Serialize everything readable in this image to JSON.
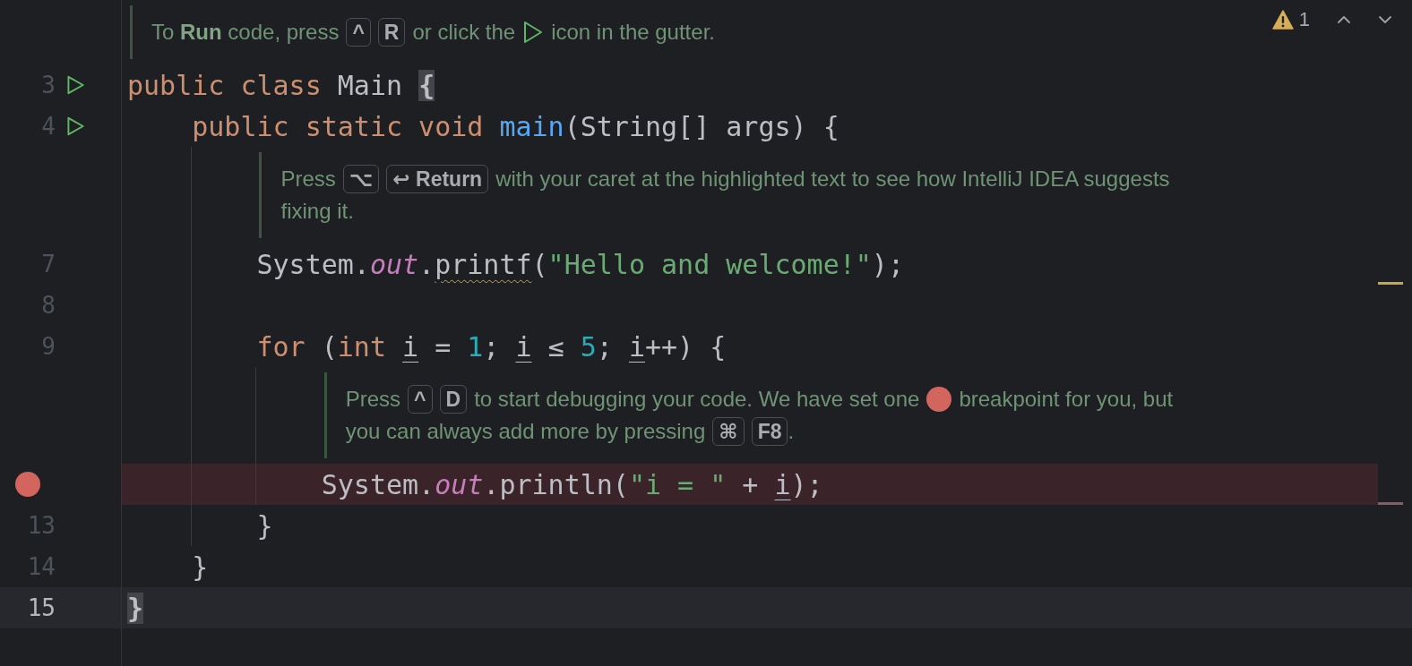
{
  "inspections": {
    "count": "1"
  },
  "lines": [
    {
      "kind": "hint",
      "lines": [
        [
          {
            "kind": "text",
            "text": "To **Run** code, press"
          },
          {
            "kind": "key",
            "text": "^"
          },
          {
            "kind": "key",
            "text": "R"
          },
          {
            "kind": "text",
            "text": "or click the"
          },
          {
            "kind": "play-icon"
          },
          {
            "kind": "text",
            "text": "icon in the gutter."
          }
        ]
      ]
    },
    {
      "kind": "code",
      "number": "3",
      "run": true,
      "breakpoint": false,
      "current": false,
      "tokens": [
        {
          "kind": "keyword",
          "text": "public class "
        },
        {
          "kind": "plain",
          "text": "Main "
        },
        {
          "kind": "brace",
          "text": "{"
        }
      ],
      "children": [
        {
          "kind": "code",
          "number": "4",
          "run": true,
          "breakpoint": false,
          "current": false,
          "tokens": [
            {
              "kind": "keyword",
              "text": "public static void "
            },
            {
              "kind": "method",
              "text": "main"
            },
            {
              "kind": "plain",
              "text": "(String[] args) {"
            }
          ],
          "children": [
            {
              "kind": "hint",
              "lines": [
                [
                  {
                    "kind": "text",
                    "text": "Press"
                  },
                  {
                    "kind": "key",
                    "text": "⌥"
                  },
                  {
                    "kind": "key",
                    "text": "↩ Return"
                  },
                  {
                    "kind": "text",
                    "text": "with your caret at the highlighted text to see how IntelliJ IDEA suggests"
                  }
                ],
                [
                  {
                    "kind": "text",
                    "text": "fixing it."
                  }
                ]
              ]
            },
            {
              "kind": "code",
              "number": "7",
              "run": false,
              "breakpoint": false,
              "current": false,
              "stripe": {
                "kind": "warning"
              },
              "tokens": [
                {
                  "kind": "plain",
                  "text": "System."
                },
                {
                  "kind": "field",
                  "text": "out"
                },
                {
                  "kind": "plain",
                  "text": "."
                },
                {
                  "kind": "warning",
                  "text": "printf"
                },
                {
                  "kind": "plain",
                  "text": "("
                },
                {
                  "kind": "string",
                  "text": "\"Hello and welcome!\""
                },
                {
                  "kind": "plain",
                  "text": ");"
                }
              ]
            },
            {
              "kind": "code",
              "number": "8",
              "run": false,
              "breakpoint": false,
              "current": false
            },
            {
              "kind": "code",
              "number": "9",
              "run": false,
              "breakpoint": false,
              "current": false,
              "tokens": [
                {
                  "kind": "keyword",
                  "text": "for "
                },
                {
                  "kind": "plain",
                  "text": "("
                },
                {
                  "kind": "keyword",
                  "text": "int "
                },
                {
                  "kind": "variable",
                  "text": "i"
                },
                {
                  "kind": "plain",
                  "text": " = "
                },
                {
                  "kind": "number",
                  "text": "1"
                },
                {
                  "kind": "plain",
                  "text": "; "
                },
                {
                  "kind": "variable",
                  "text": "i"
                },
                {
                  "kind": "plain",
                  "text": " ≤ "
                },
                {
                  "kind": "number",
                  "text": "5"
                },
                {
                  "kind": "plain",
                  "text": "; "
                },
                {
                  "kind": "variable",
                  "text": "i"
                },
                {
                  "kind": "plain",
                  "text": "++) {"
                }
              ],
              "children": [
                {
                  "kind": "hint",
                  "lines": [
                    [
                      {
                        "kind": "text",
                        "text": "Press"
                      },
                      {
                        "kind": "key",
                        "text": "^"
                      },
                      {
                        "kind": "key",
                        "text": "D"
                      },
                      {
                        "kind": "text",
                        "text": "to start debugging your code. We have set one"
                      },
                      {
                        "kind": "breakpoint-icon"
                      },
                      {
                        "kind": "text",
                        "text": "breakpoint for you, but"
                      }
                    ],
                    [
                      {
                        "kind": "text",
                        "text": "you can always add more by pressing"
                      },
                      {
                        "kind": "key",
                        "text": "⌘"
                      },
                      {
                        "kind": "key",
                        "text": "F8"
                      },
                      {
                        "kind": "punct",
                        "text": "."
                      }
                    ]
                  ]
                },
                {
                  "kind": "code",
                  "run": false,
                  "breakpoint": true,
                  "current": false,
                  "stripe": {
                    "kind": "breakpoint"
                  },
                  "tokens": [
                    {
                      "kind": "plain",
                      "text": "System."
                    },
                    {
                      "kind": "field",
                      "text": "out"
                    },
                    {
                      "kind": "plain",
                      "text": ".println("
                    },
                    {
                      "kind": "string",
                      "text": "\"i = \""
                    },
                    {
                      "kind": "plain",
                      "text": " + "
                    },
                    {
                      "kind": "variable",
                      "text": "i"
                    },
                    {
                      "kind": "plain",
                      "text": ");"
                    }
                  ]
                }
              ]
            },
            {
              "kind": "code",
              "number": "13",
              "run": false,
              "breakpoint": false,
              "current": false,
              "tokens": [
                {
                  "kind": "plain",
                  "text": "}"
                }
              ]
            }
          ]
        },
        {
          "kind": "code",
          "number": "14",
          "run": false,
          "breakpoint": false,
          "current": false,
          "tokens": [
            {
              "kind": "plain",
              "text": "}"
            }
          ]
        }
      ]
    },
    {
      "kind": "code",
      "number": "15",
      "run": false,
      "breakpoint": false,
      "current": true,
      "tokens": [
        {
          "kind": "brace",
          "text": "}"
        }
      ]
    }
  ]
}
